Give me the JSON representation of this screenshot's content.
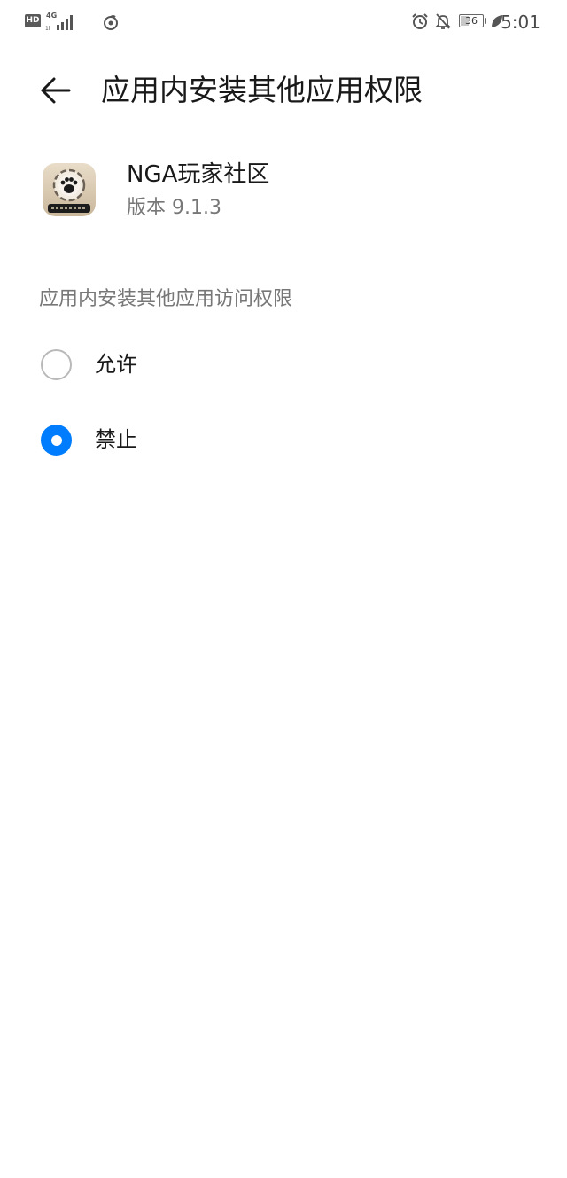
{
  "status_bar": {
    "hd_label": "HD",
    "network_label": "4G",
    "battery_level": "36",
    "battery_fraction": 0.36,
    "time": "5:01"
  },
  "header": {
    "title": "应用内安装其他应用权限"
  },
  "app": {
    "name": "NGA玩家社区",
    "version": "版本 9.1.3"
  },
  "permission": {
    "section_title": "应用内安装其他应用访问权限",
    "options": [
      {
        "label": "允许",
        "selected": false
      },
      {
        "label": "禁止",
        "selected": true
      }
    ]
  },
  "colors": {
    "accent": "#007dff",
    "text_primary": "#191919",
    "text_secondary": "#777777"
  },
  "icons": {
    "back": "arrow-left-icon",
    "alarm": "alarm-icon",
    "notifications_off": "bell-off-icon",
    "power_saving": "leaf-icon",
    "hotspot": "hotspot-icon",
    "signal": "signal-icon"
  }
}
